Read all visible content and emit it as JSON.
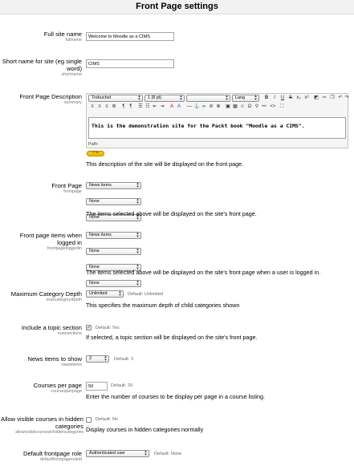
{
  "page_title": "Front Page settings",
  "fullname": {
    "label": "Full site name",
    "name": "fullname",
    "value": "Welcome to Moodle as a CIMS"
  },
  "shortname": {
    "label": "Short name for site (eg single word)",
    "name": "shortname",
    "value": "CIMS"
  },
  "summary": {
    "label": "Front Page Description",
    "name": "summary",
    "font_family": "Trebuchet",
    "font_size": "1 (8 pt)",
    "format": "",
    "lang": "Lang",
    "content": "This is the demonstration site for the Packt book \"Moodle as a CIMS\".",
    "path_label": "Path:",
    "help_label": "? ✎",
    "description": "This description of the site will be displayed on the front page."
  },
  "frontpage": {
    "label": "Front Page",
    "name": "frontpage",
    "selects": [
      "News items",
      "None",
      "None"
    ],
    "description": "The items selected above will be displayed on the site's front page."
  },
  "frontpageloggedin": {
    "label": "Front page items when logged in",
    "name": "frontpageloggedin",
    "selects": [
      "News items",
      "None",
      "None",
      "None"
    ],
    "description": "The items selected above will be displayed on the site's front page when a user is logged in."
  },
  "maxcategorydepth": {
    "label": "Maximum Category Depth",
    "name": "maxcategorydepth",
    "value": "Unlimited",
    "default": "Default: Unlimited",
    "description": "This specifies the maximum depth of child categories shown"
  },
  "numsections": {
    "label": "Include a topic section",
    "name": "numsections",
    "checked": true,
    "default": "Default: Yes",
    "description": "If selected, a topic section will be displayed on the site's front page."
  },
  "newsitems": {
    "label": "News items to show",
    "name": "newsitems",
    "value": "3",
    "default": "Default: 3"
  },
  "coursesperpage": {
    "label": "Courses per page",
    "name": "coursesperpage",
    "value": "50",
    "default": "Default: 20",
    "description": "Enter the number of courses to be display per page in a course listing."
  },
  "allowvisiblecourses": {
    "label": "Allow visible courses in hidden categories",
    "name": "allowvisiblecoursesinhiddencategories",
    "checked": false,
    "default": "Default: No",
    "description": "Display courses in hidden categories normally"
  },
  "defaultfrontpagerole": {
    "label": "Default frontpage role",
    "name": "defaultfrontpageroleid",
    "value": "Authenticated user",
    "default": "Default: None"
  }
}
